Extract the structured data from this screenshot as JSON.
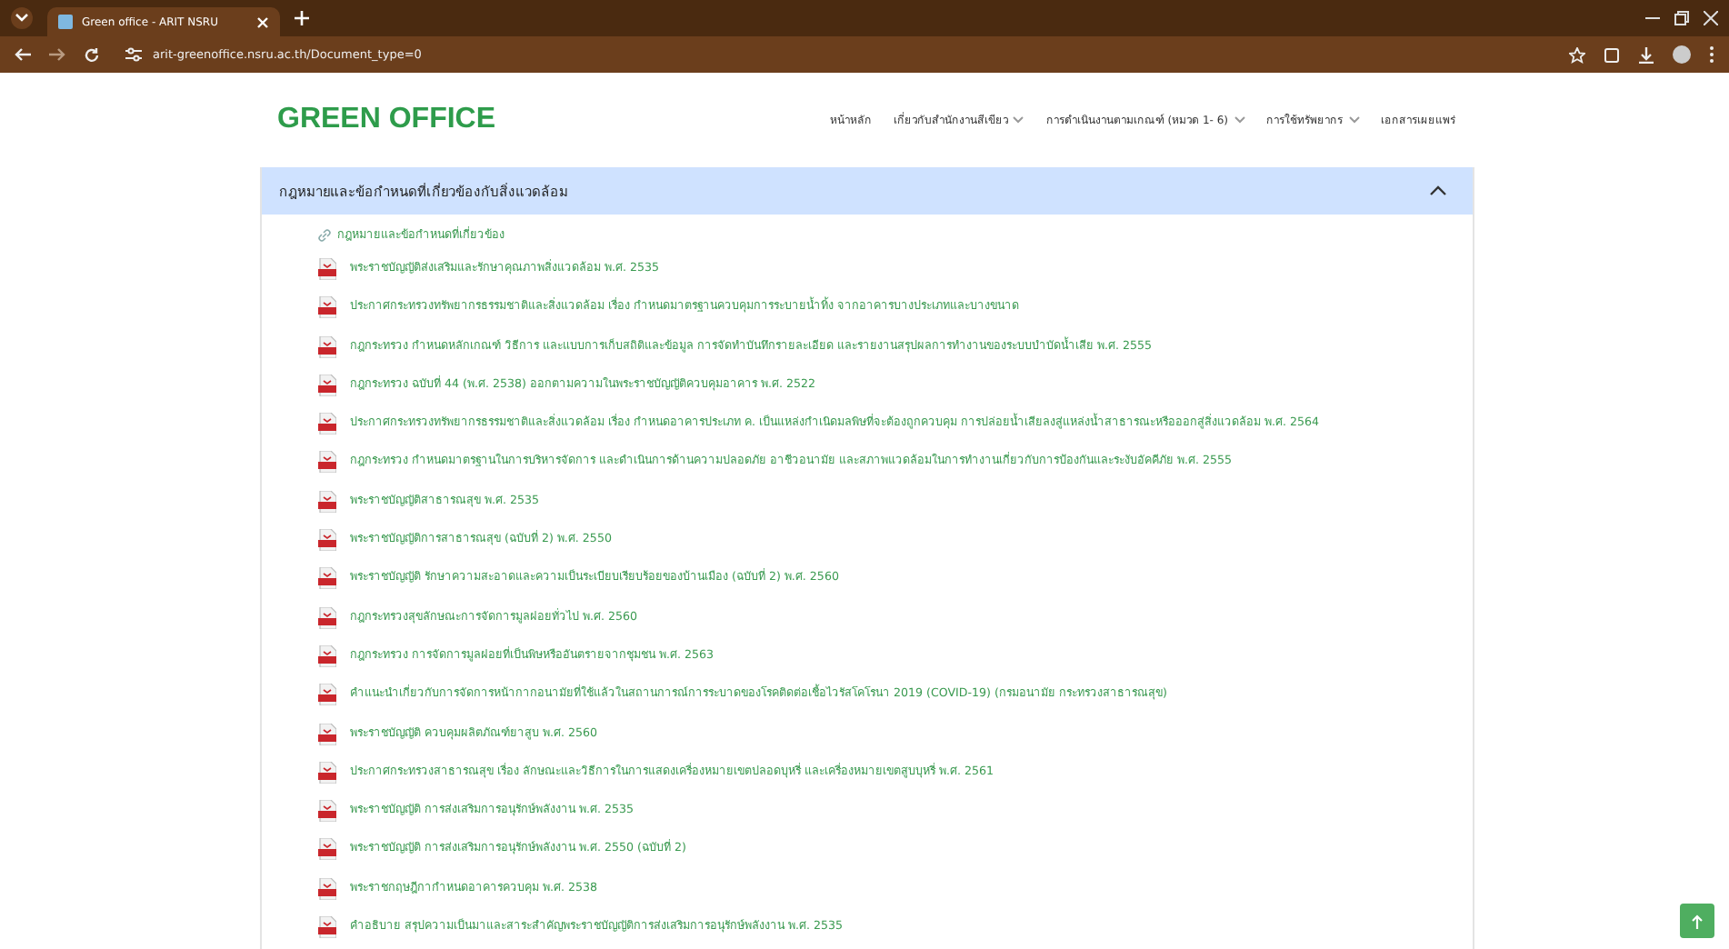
{
  "browser": {
    "tab_title": "Green office - ARIT NSRU",
    "url": "arit-greenoffice.nsru.ac.th/Document_type=0"
  },
  "site": {
    "logo": "GREEN OFFICE",
    "nav": [
      {
        "label": "หน้าหลัก",
        "dropdown": false
      },
      {
        "label": "เกี่ยวกับสำนักงานสีเขียว",
        "dropdown": true
      },
      {
        "label": "การดำเนินงานตามเกณฑ์ (หมวด 1- 6)",
        "dropdown": true
      },
      {
        "label": "การใช้ทรัพยากร",
        "dropdown": true
      },
      {
        "label": "เอกสารเผยแพร่",
        "dropdown": false
      }
    ]
  },
  "accordion": {
    "title": "กฎหมายและข้อกำหนดที่เกี่ยวข้องกับสิ่งแวดล้อม",
    "expanded": true,
    "items": [
      {
        "kind": "link",
        "text": "กฎหมายและข้อกำหนดที่เกี่ยวข้อง"
      },
      {
        "kind": "pdf",
        "text": "พระราชบัญญัติส่งเสริมและรักษาคุณภาพสิ่งแวดล้อม พ.ศ. 2535"
      },
      {
        "kind": "pdf",
        "text": "ประกาศกระทรวงทรัพยากรธรรมชาติและสิ่งแวดล้อม เรื่อง กำหนดมาตรฐานควบคุมการระบายน้ำทิ้ง จากอาคารบางประเภทและบางขนาด"
      },
      {
        "kind": "pdf",
        "text": "กฎกระทรวง กำหนดหลักเกณฑ์ วิธีการ และแบบการเก็บสถิติและข้อมูล การจัดทำบันทึกรายละเอียด และรายงานสรุปผลการทำงานของระบบบำบัดน้ำเสีย พ.ศ. 2555"
      },
      {
        "kind": "pdf",
        "text": "กฎกระทรวง ฉบับที่ 44 (พ.ศ. 2538) ออกตามความในพระราชบัญญัติควบคุมอาคาร พ.ศ. 2522"
      },
      {
        "kind": "pdf",
        "text": "ประกาศกระทรวงทรัพยากรธรรมชาติและสิ่งแวดล้อม เรื่อง กำหนดอาคารประเภท ค. เป็นแหล่งกำเนิดมลพิษที่จะต้องถูกควบคุม การปล่อยน้ำเสียลงสู่แหล่งน้ำสาธารณะหรือออกสู่สิ่งแวดล้อม พ.ศ. 2564"
      },
      {
        "kind": "pdf",
        "text": "กฎกระทรวง กำหนดมาตรฐานในการบริหารจัดการ และดำเนินการด้านความปลอดภัย อาชีวอนามัย และสภาพแวดล้อมในการทำงานเกี่ยวกับการป้องกันและระงับอัคคีภัย พ.ศ. 2555"
      },
      {
        "kind": "pdf",
        "text": "พระราชบัญญัติสาธารณสุข พ.ศ. 2535"
      },
      {
        "kind": "pdf",
        "text": "พระราชบัญญัติการสาธารณสุข (ฉบับที่ 2) พ.ศ. 2550"
      },
      {
        "kind": "pdf",
        "text": "พระราชบัญญัติ รักษาความสะอาดและความเป็นระเบียบเรียบร้อยของบ้านเมือง (ฉบับที่ 2) พ.ศ. 2560"
      },
      {
        "kind": "pdf",
        "text": "กฎกระทรวงสุขลักษณะการจัดการมูลฝอยทั่วไป พ.ศ. 2560"
      },
      {
        "kind": "pdf",
        "text": "กฎกระทรวง การจัดการมูลฝอยที่เป็นพิษหรืออันตรายจากชุมชน พ.ศ. 2563"
      },
      {
        "kind": "pdf",
        "text": "คำแนะนำเกี่ยวกับการจัดการหน้ากากอนามัยที่ใช้แล้วในสถานการณ์การระบาดของโรคติดต่อเชื้อไวรัสโคโรนา 2019 (COVID-19) (กรมอนามัย กระทรวงสาธารณสุข)"
      },
      {
        "kind": "pdf",
        "text": "พระราชบัญญัติ ควบคุมผลิตภัณฑ์ยาสูบ พ.ศ. 2560"
      },
      {
        "kind": "pdf",
        "text": "ประกาศกระทรวงสาธารณสุข เรื่อง ลักษณะและวิธีการในการแสดงเครื่องหมายเขตปลอดบุหรี่ และเครื่องหมายเขตสูบบุหรี่ พ.ศ. 2561"
      },
      {
        "kind": "pdf",
        "text": "พระราชบัญญัติ การส่งเสริมการอนุรักษ์พลังงาน พ.ศ. 2535"
      },
      {
        "kind": "pdf",
        "text": "พระราชบัญญัติ การส่งเสริมการอนุรักษ์พลังงาน พ.ศ. 2550 (ฉบับที่ 2)"
      },
      {
        "kind": "pdf",
        "text": "พระราชกฤษฎีกากำหนดอาคารควบคุม พ.ศ. 2538"
      },
      {
        "kind": "pdf",
        "text": "คำอธิบาย สรุปความเป็นมาและสาระสำคัญพระราชบัญญัติการส่งเสริมการอนุรักษ์พลังงาน พ.ศ. 2535"
      }
    ]
  }
}
